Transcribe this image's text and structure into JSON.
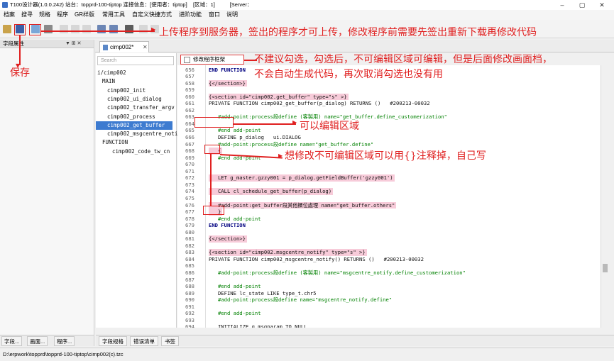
{
  "window": {
    "title": "T100设计器(1.0.0.242) 站台：topprd-100-tiptop 连接信息：[使用者：tiptop]    [区域：1]          [Server：",
    "controls": [
      "–",
      "▢",
      "✕"
    ]
  },
  "menu": [
    "档案",
    "搜寻",
    "规格",
    "程序",
    "GR样版",
    "常用工具",
    "自定义快捷方式",
    "进阶功能",
    "窗口",
    "说明"
  ],
  "left_panel": {
    "title": "字段属性",
    "header_icons": "▼ ⊞ ✕",
    "tabs": [
      "字段...",
      "画面...",
      "程序..."
    ]
  },
  "editor": {
    "tab_label": "cimp002*",
    "tab_close": "✕",
    "search_placeholder": "Search",
    "checkbox_label": "修改程序框架",
    "tree": [
      {
        "label": "i/cimp002",
        "depth": 0
      },
      {
        "label": "MAIN",
        "depth": 1
      },
      {
        "label": "cimp002_init",
        "depth": 2
      },
      {
        "label": "cimp002_ui_dialog",
        "depth": 2
      },
      {
        "label": "cimp002_transfer_argv",
        "depth": 2
      },
      {
        "label": "cimp002_process",
        "depth": 2
      },
      {
        "label": "cimp002_get_buffer",
        "depth": 2,
        "selected": true
      },
      {
        "label": "cimp002_msgcentre_notify",
        "depth": 2
      },
      {
        "label": "FUNCTION",
        "depth": 1
      },
      {
        "label": "cimp002_code_tw_cn",
        "depth": 3
      }
    ],
    "lines": [
      {
        "n": "656",
        "t": "END FUNCTION",
        "k": "kw"
      },
      {
        "n": "657",
        "t": ""
      },
      {
        "n": "658",
        "t": "{</section>}",
        "k": "hl"
      },
      {
        "n": "659",
        "t": ""
      },
      {
        "n": "660",
        "t": "{<section id=\"cimp002.get_buffer\" type=\"s\" >}",
        "k": "hl"
      },
      {
        "n": "661",
        "t": "PRIVATE FUNCTION cimp002_get_buffer(p_dialog) RETURNS ()   #200213-00032"
      },
      {
        "n": "662",
        "t": ""
      },
      {
        "n": "663",
        "t": "   #add-point:process段define (客製用) name=\"get_buffer.define_customerization\"",
        "k": "cm"
      },
      {
        "n": "664",
        "t": ""
      },
      {
        "n": "665",
        "t": "   #end add-point",
        "k": "cm"
      },
      {
        "n": "666",
        "t": "   DEFINE p_dialog   ui.DIALOG"
      },
      {
        "n": "667",
        "t": "   #add-point:process段define name=\"get_buffer.define\"",
        "k": "cm"
      },
      {
        "n": "668",
        "t": "   {",
        "k": "hl"
      },
      {
        "n": "669",
        "t": "   #end add-point",
        "k": "cm"
      },
      {
        "n": "670",
        "t": ""
      },
      {
        "n": "671",
        "t": "",
        "k": "hl"
      },
      {
        "n": "672",
        "t": "   LET g_master.gzzy001 = p_dialog.getFieldBuffer('gzzy001')",
        "k": "hl"
      },
      {
        "n": "673",
        "t": "",
        "k": "hl"
      },
      {
        "n": "674",
        "t": "   CALL cl_schedule_get_buffer(p_dialog)",
        "k": "hl"
      },
      {
        "n": "675",
        "t": "",
        "k": "hl"
      },
      {
        "n": "676",
        "t": "   #add-point:get_buffer段其他欄位處理 name=\"get_buffer.others\"",
        "k": "hl"
      },
      {
        "n": "677",
        "t": "   }",
        "k": "hl"
      },
      {
        "n": "678",
        "t": "   #end add-point",
        "k": "cm"
      },
      {
        "n": "679",
        "t": "END FUNCTION",
        "k": "kw"
      },
      {
        "n": "680",
        "t": ""
      },
      {
        "n": "681",
        "t": "{</section>}",
        "k": "hl"
      },
      {
        "n": "682",
        "t": ""
      },
      {
        "n": "683",
        "t": "{<section id=\"cimp002.msgcentre_notify\" type=\"s\" >}",
        "k": "hl"
      },
      {
        "n": "684",
        "t": "PRIVATE FUNCTION cimp002_msgcentre_notify() RETURNS ()   #200213-00032"
      },
      {
        "n": "685",
        "t": ""
      },
      {
        "n": "686",
        "t": "   #add-point:process段define (客製用) name=\"msgcentre_notify.define_customerization\"",
        "k": "cm"
      },
      {
        "n": "687",
        "t": ""
      },
      {
        "n": "688",
        "t": "   #end add-point",
        "k": "cm"
      },
      {
        "n": "689",
        "t": "   DEFINE lc_state LIKE type_t.chr5"
      },
      {
        "n": "690",
        "t": "   #add-point:process段define name=\"msgcentre_notify.define\"",
        "k": "cm"
      },
      {
        "n": "691",
        "t": ""
      },
      {
        "n": "692",
        "t": "   #end add-point",
        "k": "cm"
      },
      {
        "n": "693",
        "t": ""
      },
      {
        "n": "694",
        "t": "   INITIALIZE g_msgparam TO NULL"
      }
    ]
  },
  "bottom_tabs": [
    "字段规格",
    "错误清单",
    "书签"
  ],
  "status_path": "D:\\erpwork\\topprd\\topprd-100-tiptop\\cimp002(c).tzc",
  "annotations": {
    "upload": "上传程序到服务器，签出的程序才可上传，修改程序前需要先签出重新下载再修改代码",
    "save": "保存",
    "framework_line1": "不建议勾选，勾选后，不可编辑区域可编辑，但是后面修改画面档，",
    "framework_line2": "不会自动生成代码，再次取消勾选也没有用",
    "editable": "可以编辑区域",
    "comment_out": "想修改不可编辑区域可以用{}注释掉，自己写"
  },
  "colors": {
    "annotation": "#e02020",
    "highlight": "#f7cbd9",
    "selection": "#3d7bd0"
  }
}
